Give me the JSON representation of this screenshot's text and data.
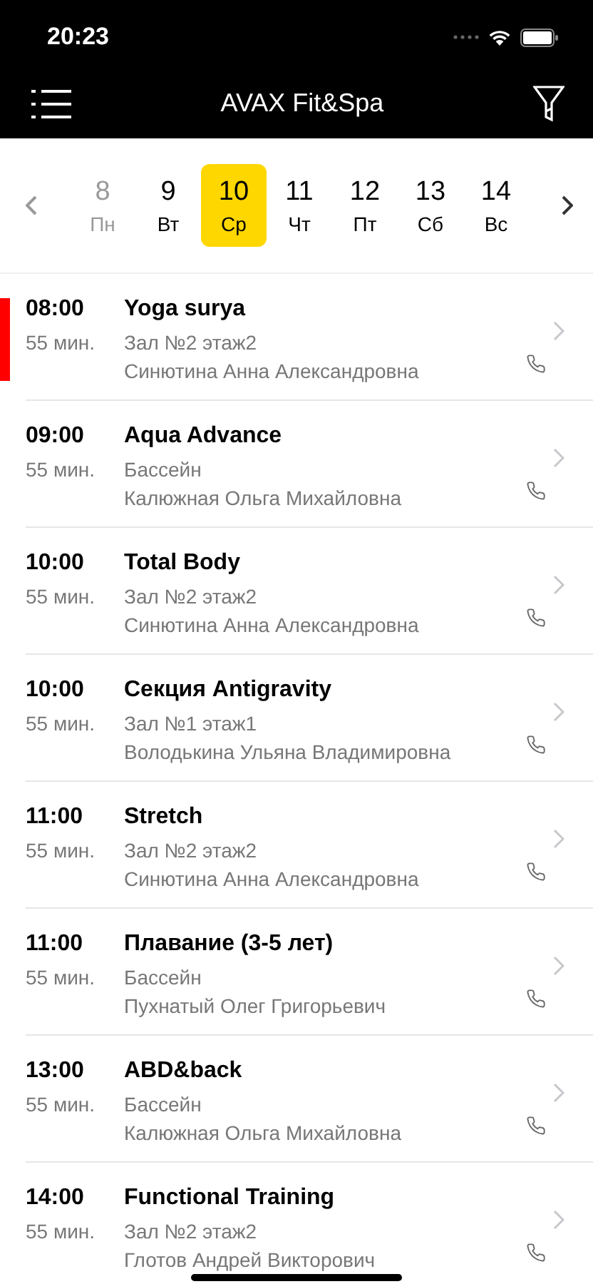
{
  "status_bar": {
    "time": "20:23"
  },
  "nav": {
    "title": "AVAX Fit&Spa"
  },
  "days": [
    {
      "number": "8",
      "weekday": "Пн",
      "selected": false,
      "disabled": true
    },
    {
      "number": "9",
      "weekday": "Вт",
      "selected": false,
      "disabled": false
    },
    {
      "number": "10",
      "weekday": "Ср",
      "selected": true,
      "disabled": false
    },
    {
      "number": "11",
      "weekday": "Чт",
      "selected": false,
      "disabled": false
    },
    {
      "number": "12",
      "weekday": "Пт",
      "selected": false,
      "disabled": false
    },
    {
      "number": "13",
      "weekday": "Сб",
      "selected": false,
      "disabled": false
    },
    {
      "number": "14",
      "weekday": "Вс",
      "selected": false,
      "disabled": false
    }
  ],
  "classes": [
    {
      "time": "08:00",
      "duration": "55 мин.",
      "title": "Yoga surya",
      "room": "Зал №2 этаж2",
      "trainer": "Синютина Анна Александровна",
      "current": true
    },
    {
      "time": "09:00",
      "duration": "55 мин.",
      "title": "Aqua Advance",
      "room": "Бассейн",
      "trainer": "Калюжная Ольга Михайловна",
      "current": false
    },
    {
      "time": "10:00",
      "duration": "55 мин.",
      "title": "Total Body",
      "room": "Зал №2 этаж2",
      "trainer": "Синютина Анна Александровна",
      "current": false
    },
    {
      "time": "10:00",
      "duration": "55 мин.",
      "title": "Секция Antigravity",
      "room": "Зал №1 этаж1",
      "trainer": "Володькина Ульяна Владимировна",
      "current": false
    },
    {
      "time": "11:00",
      "duration": "55 мин.",
      "title": "Stretch",
      "room": "Зал №2 этаж2",
      "trainer": "Синютина Анна Александровна",
      "current": false
    },
    {
      "time": "11:00",
      "duration": "55 мин.",
      "title": "Плавание (3-5 лет)",
      "room": "Бассейн",
      "trainer": "Пухнатый Олег Григорьевич",
      "current": false
    },
    {
      "time": "13:00",
      "duration": "55 мин.",
      "title": "ABD&back",
      "room": "Бассейн",
      "trainer": "Калюжная Ольга Михайловна",
      "current": false
    },
    {
      "time": "14:00",
      "duration": "55 мин.",
      "title": "Functional Training",
      "room": "Зал №2 этаж2",
      "trainer": "Глотов Андрей Викторович",
      "current": false
    }
  ]
}
